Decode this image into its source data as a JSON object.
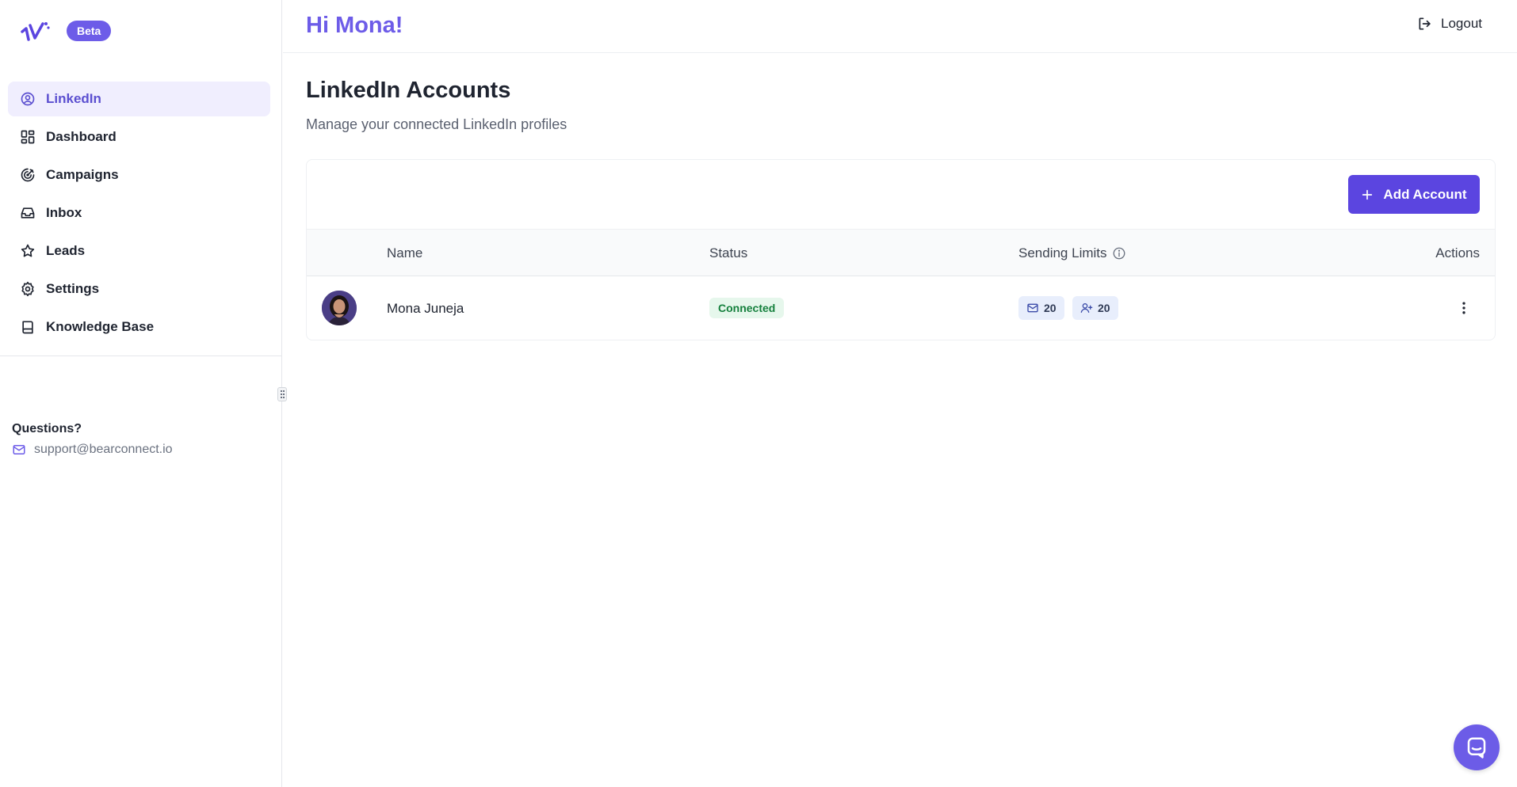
{
  "sidebar": {
    "beta_label": "Beta",
    "items": [
      {
        "label": "LinkedIn",
        "icon": "user-circle-icon",
        "active": true
      },
      {
        "label": "Dashboard",
        "icon": "grid-icon"
      },
      {
        "label": "Campaigns",
        "icon": "target-icon"
      },
      {
        "label": "Inbox",
        "icon": "inbox-icon"
      },
      {
        "label": "Leads",
        "icon": "star-icon"
      },
      {
        "label": "Settings",
        "icon": "gear-icon"
      },
      {
        "label": "Knowledge Base",
        "icon": "book-icon"
      }
    ],
    "questions_title": "Questions?",
    "support_email": "support@bearconnect.io"
  },
  "header": {
    "greeting": "Hi Mona!",
    "logout_label": "Logout"
  },
  "main": {
    "title": "LinkedIn Accounts",
    "subtitle": "Manage your connected LinkedIn profiles",
    "add_button_label": "Add Account",
    "table": {
      "headers": {
        "name": "Name",
        "status": "Status",
        "sending_limits": "Sending Limits",
        "actions": "Actions"
      },
      "rows": [
        {
          "name": "Mona Juneja",
          "status": "Connected",
          "message_limit": "20",
          "connection_limit": "20"
        }
      ]
    }
  },
  "colors": {
    "accent": "#6d5ce8",
    "button": "#5b45e0",
    "status_connected_bg": "#e6f7ec",
    "status_connected_text": "#15803d"
  }
}
